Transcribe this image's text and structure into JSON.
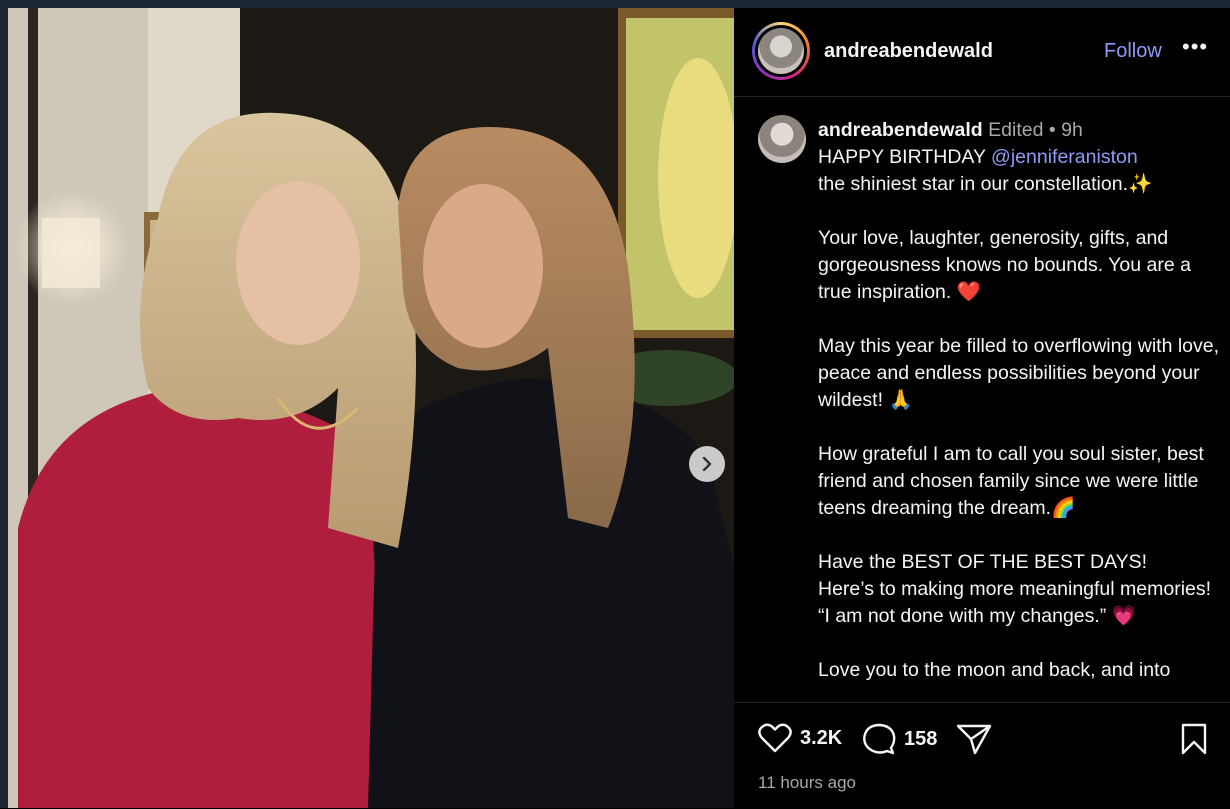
{
  "header": {
    "username": "andreabendewald",
    "follow_label": "Follow",
    "more_label": "•••"
  },
  "caption": {
    "username": "andreabendewald",
    "edited": "Edited",
    "dot": " • ",
    "age": "9h",
    "line1_prefix": "HAPPY BIRTHDAY ",
    "mention": "@jenniferaniston",
    "line2": "the shiniest star in our constellation.✨",
    "para2": "Your love, laughter, generosity, gifts, and gorgeousness knows no bounds. You are a true inspiration. ❤️",
    "para3": "May this year be filled to overflowing with love, peace and endless possibilities beyond your wildest! 🙏",
    "para4": "How grateful I am to call you soul sister, best friend and chosen family since we were little teens dreaming the dream.🌈",
    "para5_l1": "Have the BEST OF THE BEST DAYS!",
    "para5_l2": "Here’s to making more meaningful memories!",
    "para5_l3": "“I am not done with my changes.” 💗",
    "para6": "Love you to the moon and back, and into"
  },
  "actions": {
    "likes": "3.2K",
    "comments": "158",
    "timestamp": "11 hours ago"
  },
  "icons": {
    "like": "heart-icon",
    "comment": "comment-icon",
    "share": "share-icon",
    "save": "bookmark-icon",
    "next": "chevron-right-icon"
  },
  "colors": {
    "link": "#8b9cf7",
    "muted": "#a8a8a8",
    "background": "#000000"
  }
}
